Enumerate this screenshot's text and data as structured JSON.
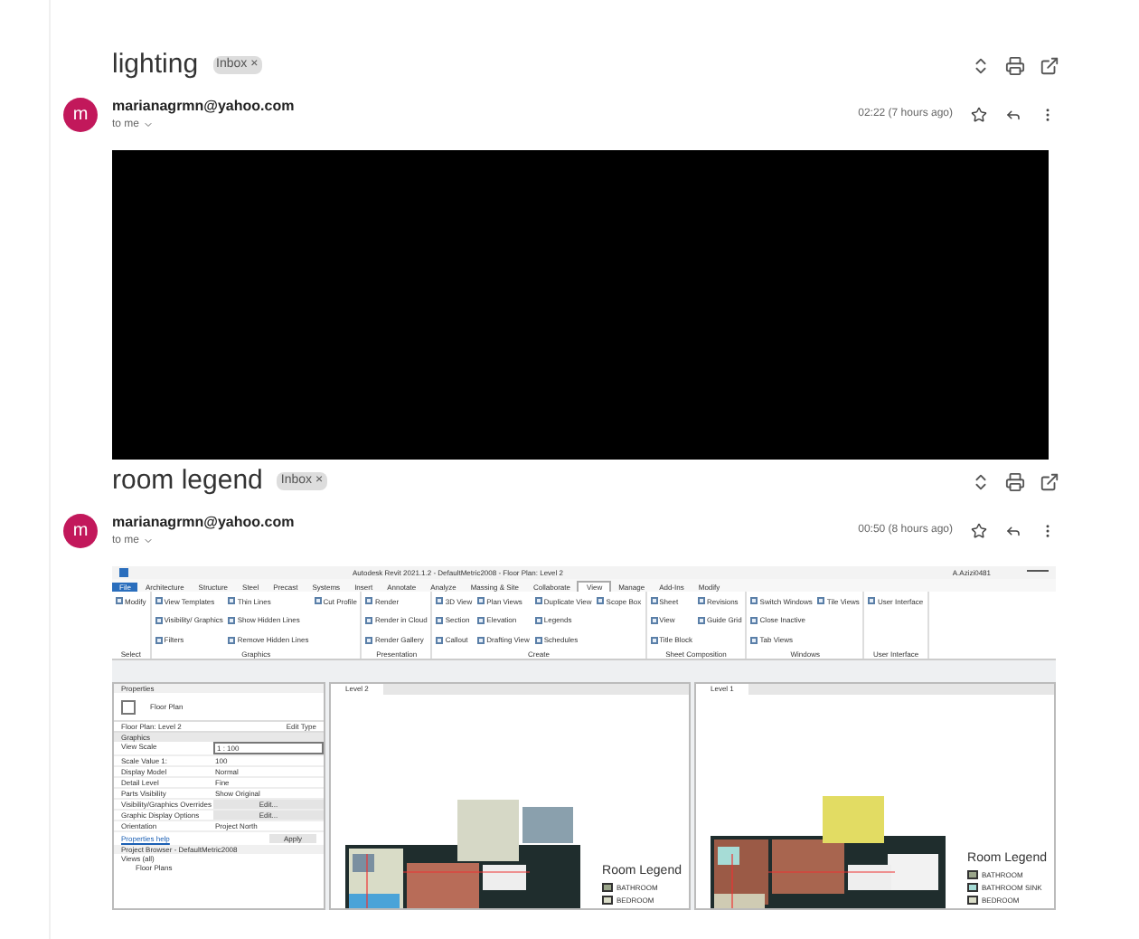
{
  "messages": [
    {
      "subject": "lighting",
      "label": "Inbox",
      "remove": "×",
      "sender": "marianagrmn@yahoo.com",
      "avatar": "m",
      "recipient": "to me",
      "time": "02:22 (7 hours ago)",
      "attachment": {
        "kind": "black"
      }
    },
    {
      "subject": "room legend",
      "label": "Inbox",
      "remove": "×",
      "sender": "marianagrmn@yahoo.com",
      "avatar": "m",
      "recipient": "to me",
      "time": "00:50 (8 hours ago)",
      "attachment": {
        "kind": "revit",
        "title": "Autodesk Revit 2021.1.2 - DefaultMetric2008 - Floor Plan: Level 2",
        "user": "A.Azizi0481",
        "tabs": [
          {
            "label": "File",
            "kind": "application",
            "selected": false
          },
          {
            "label": "Architecture",
            "selected": false
          },
          {
            "label": "Structure",
            "selected": false
          },
          {
            "label": "Steel",
            "selected": false
          },
          {
            "label": "Precast",
            "selected": false
          },
          {
            "label": "Systems",
            "selected": false
          },
          {
            "label": "Insert",
            "selected": false
          },
          {
            "label": "Annotate",
            "selected": false
          },
          {
            "label": "Analyze",
            "selected": false
          },
          {
            "label": "Massing & Site",
            "selected": false
          },
          {
            "label": "Collaborate",
            "selected": false
          },
          {
            "label": "View",
            "selected": true
          },
          {
            "label": "Manage",
            "selected": false
          },
          {
            "label": "Add-Ins",
            "selected": false
          },
          {
            "label": "Modify",
            "selected": false
          }
        ],
        "groups": [
          {
            "name": "Select",
            "tools": [
              "Modify"
            ]
          },
          {
            "name": "Graphics",
            "tools": [
              "View Templates",
              "Visibility/ Graphics",
              "Filters",
              "Thin Lines",
              "Show Hidden Lines",
              "Remove Hidden Lines",
              "Cut Profile"
            ]
          },
          {
            "name": "Presentation",
            "tools": [
              "Render",
              "Render in Cloud",
              "Render Gallery"
            ]
          },
          {
            "name": "Create",
            "tools": [
              "3D View",
              "Section",
              "Callout",
              "Plan Views",
              "Elevation",
              "Drafting View",
              "Duplicate View",
              "Legends",
              "Schedules",
              "Scope Box"
            ]
          },
          {
            "name": "Sheet Composition",
            "tools": [
              "Sheet",
              "View",
              "Title Block",
              "Revisions",
              "Guide Grid"
            ]
          },
          {
            "name": "Windows",
            "tools": [
              "Switch Windows",
              "Close Inactive",
              "Tab Views",
              "Tile Views"
            ]
          },
          {
            "name": "User Interface",
            "tools": [
              "User Interface"
            ]
          }
        ],
        "properties": {
          "title": "Properties",
          "type": "Floor Plan",
          "instance": "Floor Plan: Level 2",
          "edit_type": "Edit Type",
          "section": "Graphics",
          "rows": [
            {
              "name": "View Scale",
              "value": "1 : 100",
              "kind": "field"
            },
            {
              "name": "Scale Value    1:",
              "value": "100",
              "kind": "text"
            },
            {
              "name": "Display Model",
              "value": "Normal",
              "kind": "text"
            },
            {
              "name": "Detail Level",
              "value": "Fine",
              "kind": "text"
            },
            {
              "name": "Parts Visibility",
              "value": "Show Original",
              "kind": "text"
            },
            {
              "name": "Visibility/Graphics Overrides",
              "value": "Edit...",
              "kind": "button"
            },
            {
              "name": "Graphic Display Options",
              "value": "Edit...",
              "kind": "button"
            },
            {
              "name": "Orientation",
              "value": "Project North",
              "kind": "text"
            }
          ],
          "help": "Properties help",
          "apply": "Apply",
          "browser": "Project Browser - DefaultMetric2008",
          "tree": [
            {
              "label": "Views (all)",
              "children": [
                {
                  "label": "Floor Plans"
                }
              ]
            }
          ]
        },
        "views": [
          {
            "tab": "Level 2",
            "legend_title": "Room Legend",
            "legend": [
              {
                "label": "BATHROOM",
                "color": "#9aa58a"
              },
              {
                "label": "BEDROOM",
                "color": "#d9dcc7"
              }
            ]
          },
          {
            "tab": "Level 1",
            "legend_title": "Room Legend",
            "legend": [
              {
                "label": "BATHROOM",
                "color": "#9aa58a"
              },
              {
                "label": "BATHROOM SINK",
                "color": "#a6dcd6"
              },
              {
                "label": "BEDROOM",
                "color": "#d9dcc7"
              }
            ]
          }
        ]
      }
    }
  ]
}
